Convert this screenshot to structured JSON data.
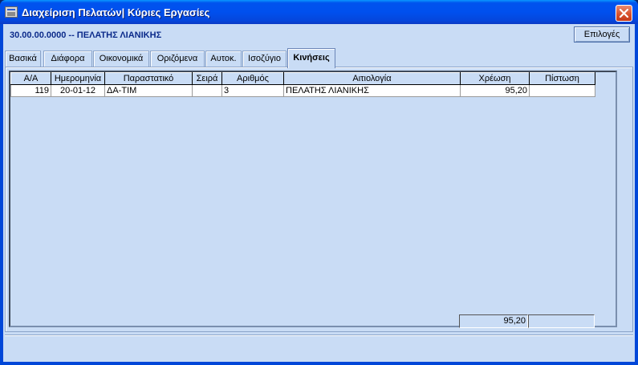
{
  "window": {
    "title": "Διαχείριση Πελατών| Κύριες Εργασίες"
  },
  "header": {
    "customer": "30.00.00.0000 -- ΠΕΛΑΤΗΣ ΛΙΑΝΙΚΗΣ",
    "options_label": "Επιλογές"
  },
  "tabs": [
    {
      "label": "Βασικά",
      "active": false
    },
    {
      "label": "Διάφορα",
      "active": false
    },
    {
      "label": "Οικονομικά",
      "active": false
    },
    {
      "label": "Οριζόμενα",
      "active": false
    },
    {
      "label": "Αυτοκ.",
      "active": false
    },
    {
      "label": "Ισοζύγιο",
      "active": false
    },
    {
      "label": "Κινήσεις",
      "active": true
    }
  ],
  "table": {
    "columns": [
      "Α/Α",
      "Ημερομηνία",
      "Παραστατικό",
      "Σειρά",
      "Αριθμός",
      "Αιτιολογία",
      "Χρέωση",
      "Πίστωση"
    ],
    "rows": [
      [
        "119",
        "20-01-12",
        "ΔΑ-ΤΙΜ",
        "",
        "3",
        "ΠΕΛΑΤΗΣ ΛΙΑΝΙΚΗΣ",
        "95,20",
        ""
      ]
    ]
  },
  "totals": {
    "debit": "95,20",
    "credit": ""
  }
}
